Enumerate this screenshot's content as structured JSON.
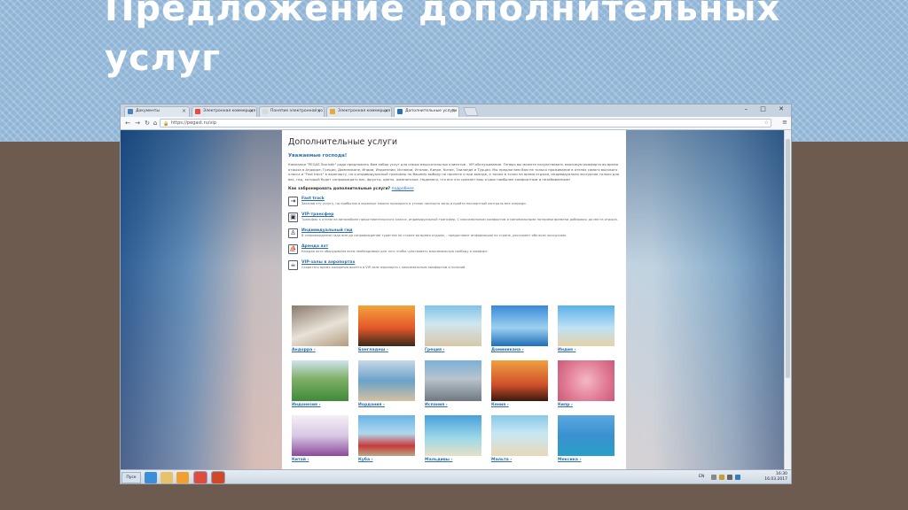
{
  "slide": {
    "title_line1": "Предложение дополнительных",
    "title_line2": "услуг"
  },
  "browser": {
    "tabs": [
      {
        "label": "Документы",
        "icon": "doc-icon",
        "color": "#4a7fc0"
      },
      {
        "label": "Электронная коммерция",
        "icon": "yandex-icon",
        "color": "#e84a3c"
      },
      {
        "label": "Понятие электронной ко",
        "icon": "doc-icon",
        "color": "#d9d9d9"
      },
      {
        "label": "Электронная коммерция",
        "icon": "folder-icon",
        "color": "#e6a93c"
      },
      {
        "label": "Дополнительные услуги",
        "icon": "pegas-icon",
        "color": "#2c6fb0"
      }
    ],
    "url": "https://pegast.ru/vip",
    "window_buttons": "–  □  ✕"
  },
  "page": {
    "heading": "Дополнительные услуги",
    "greeting": "Уважаемые господа!",
    "intro": "Компания \"PEGAS Touristik\" рада предложить Вам набор услуг для самых взыскательных клиентов - VIP-обслуживание. Теперь вы можете почувствовать максимум комфорта во время отдыха в Андорре, Греции, Доминикане, Индии, Индонезии, Испании, Италии, Кипре, Китае, Таиланде и Турции. Мы предлагаем Вам не только проживание в отелях самого высокого класса и \"Fast track\" в аэропорту, но и индивидуальный трансфер по Вашему выбору на прилете и при выезде, а также в точки на время отдыха, индивидуально экскурсии только для вас, гид, который будет сопровождать вас, фрукты, цветы, шампанское. Надеемся, что все это сделает ваш отдых наиболее комфортным и незабываемым!",
    "howto_label": "Как забронировать дополнительные услуги?",
    "howto_link": "подробнее",
    "services": [
      {
        "name": "Fast track",
        "icon": "fast-track-icon",
        "glyph": "⇥",
        "desc": "Заказав эту услугу, по прибытии в аэропорт можно проходить в уголок паспорта зоны и пройти паспортный контроль вне очереди."
      },
      {
        "name": "VIP-трансфер",
        "icon": "car-icon",
        "glyph": "▣",
        "desc": "Трансфер к отелю на автомобиле представительского класса, индивидуальный трансфер. С максимальным комфортом и минимальными потерями времени добираясь до места отдыха."
      },
      {
        "name": "Индивидуальный гид",
        "icon": "guide-icon",
        "glyph": "♙",
        "desc": "В сопровождении гида всегда сопровождение туристов по стране во время отдыха, - предоставит информацию по стране, расскажет обо всех экскурсиях."
      },
      {
        "name": "Аренда яхт",
        "icon": "yacht-icon",
        "glyph": "⛵",
        "desc": "Каждая яхта оборудована всем необходимым для того чтобы чувствовать максимальную свободу и комфорт."
      },
      {
        "name": "VIP-залы в аэропортах",
        "icon": "lounge-icon",
        "glyph": "☕",
        "desc": "Скоротать время ожидания вылета в VIP-зале аэропорта с максимальным комфортом и пользой."
      }
    ],
    "destinations": [
      {
        "name": "Андорра",
        "image": "spa-photo"
      },
      {
        "name": "Бангладеш",
        "image": "temple-sunset-photo"
      },
      {
        "name": "Греция",
        "image": "pool-terrace-photo"
      },
      {
        "name": "Доминикана",
        "image": "catamaran-photo"
      },
      {
        "name": "Индия",
        "image": "beach-woman-photo"
      },
      {
        "name": "Индонезия",
        "image": "golf-photo"
      },
      {
        "name": "Иордания",
        "image": "sea-couple-photo"
      },
      {
        "name": "Испания",
        "image": "convertible-photo"
      },
      {
        "name": "Кения",
        "image": "savanna-sunset-photo"
      },
      {
        "name": "Кипр",
        "image": "petals-photo"
      },
      {
        "name": "Китай",
        "image": "bags-photo"
      },
      {
        "name": "Куба",
        "image": "retro-car-photo"
      },
      {
        "name": "Мальдивы",
        "image": "palm-beach-photo"
      },
      {
        "name": "Мальта",
        "image": "beach-umbrellas-photo"
      },
      {
        "name": "Мексика",
        "image": "pier-photo"
      }
    ]
  },
  "taskbar": {
    "start": "Пуск",
    "lang": "EN",
    "time": "16:30",
    "date": "16.03.2017",
    "apps": [
      {
        "name": "ie-icon",
        "color": "#3a8fd8"
      },
      {
        "name": "explorer-icon",
        "color": "#e6c26a"
      },
      {
        "name": "media-player-icon",
        "color": "#f0a030"
      },
      {
        "name": "chrome-icon",
        "color": "#e04c3c"
      },
      {
        "name": "powerpoint-icon",
        "color": "#d24726"
      }
    ]
  }
}
